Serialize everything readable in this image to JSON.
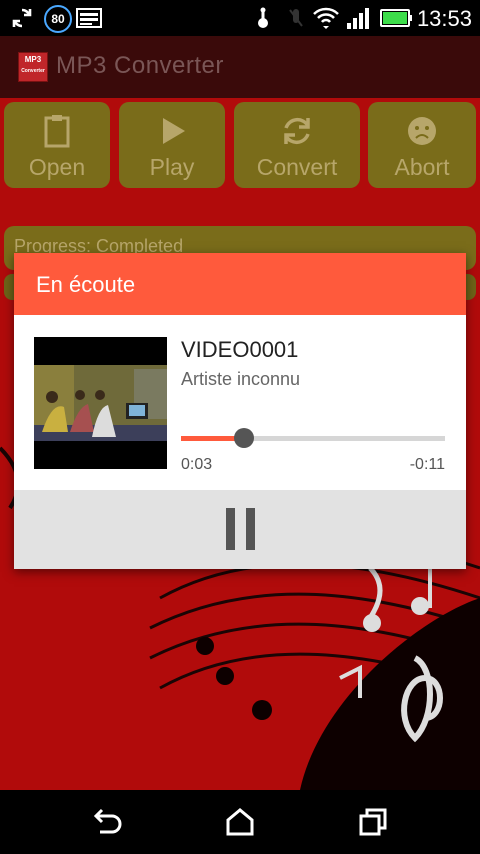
{
  "status_bar": {
    "time": "13:53",
    "badge": "80",
    "icons": [
      "sync-icon",
      "badge-80-icon",
      "image-icon",
      "usb-icon",
      "mute-icon",
      "wifi-icon",
      "signal-icon",
      "battery-icon"
    ],
    "battery_color": "#3ddc4a"
  },
  "app_bar": {
    "title": "MP3 Converter",
    "logo_text_top": "MP3",
    "logo_text_bottom": "Converter"
  },
  "toolbar": {
    "buttons": [
      {
        "label": "Open",
        "icon": "clipboard-icon"
      },
      {
        "label": "Play",
        "icon": "play-icon"
      },
      {
        "label": "Convert",
        "icon": "refresh-icon"
      },
      {
        "label": "Abort",
        "icon": "sad-face-icon"
      }
    ]
  },
  "progress": {
    "text": "Progress: Completed"
  },
  "dialog": {
    "title": "En écoute",
    "track_title": "VIDEO0001",
    "artist": "Artiste inconnu",
    "elapsed": "0:03",
    "remaining": "-0:11",
    "progress_fraction": 0.24
  },
  "navbar": {
    "buttons": [
      "back-icon",
      "home-icon",
      "recent-apps-icon"
    ]
  },
  "colors": {
    "accent": "#ff5a3c",
    "background_red": "#b10b0b",
    "button_olive": "#7a6c1a"
  }
}
